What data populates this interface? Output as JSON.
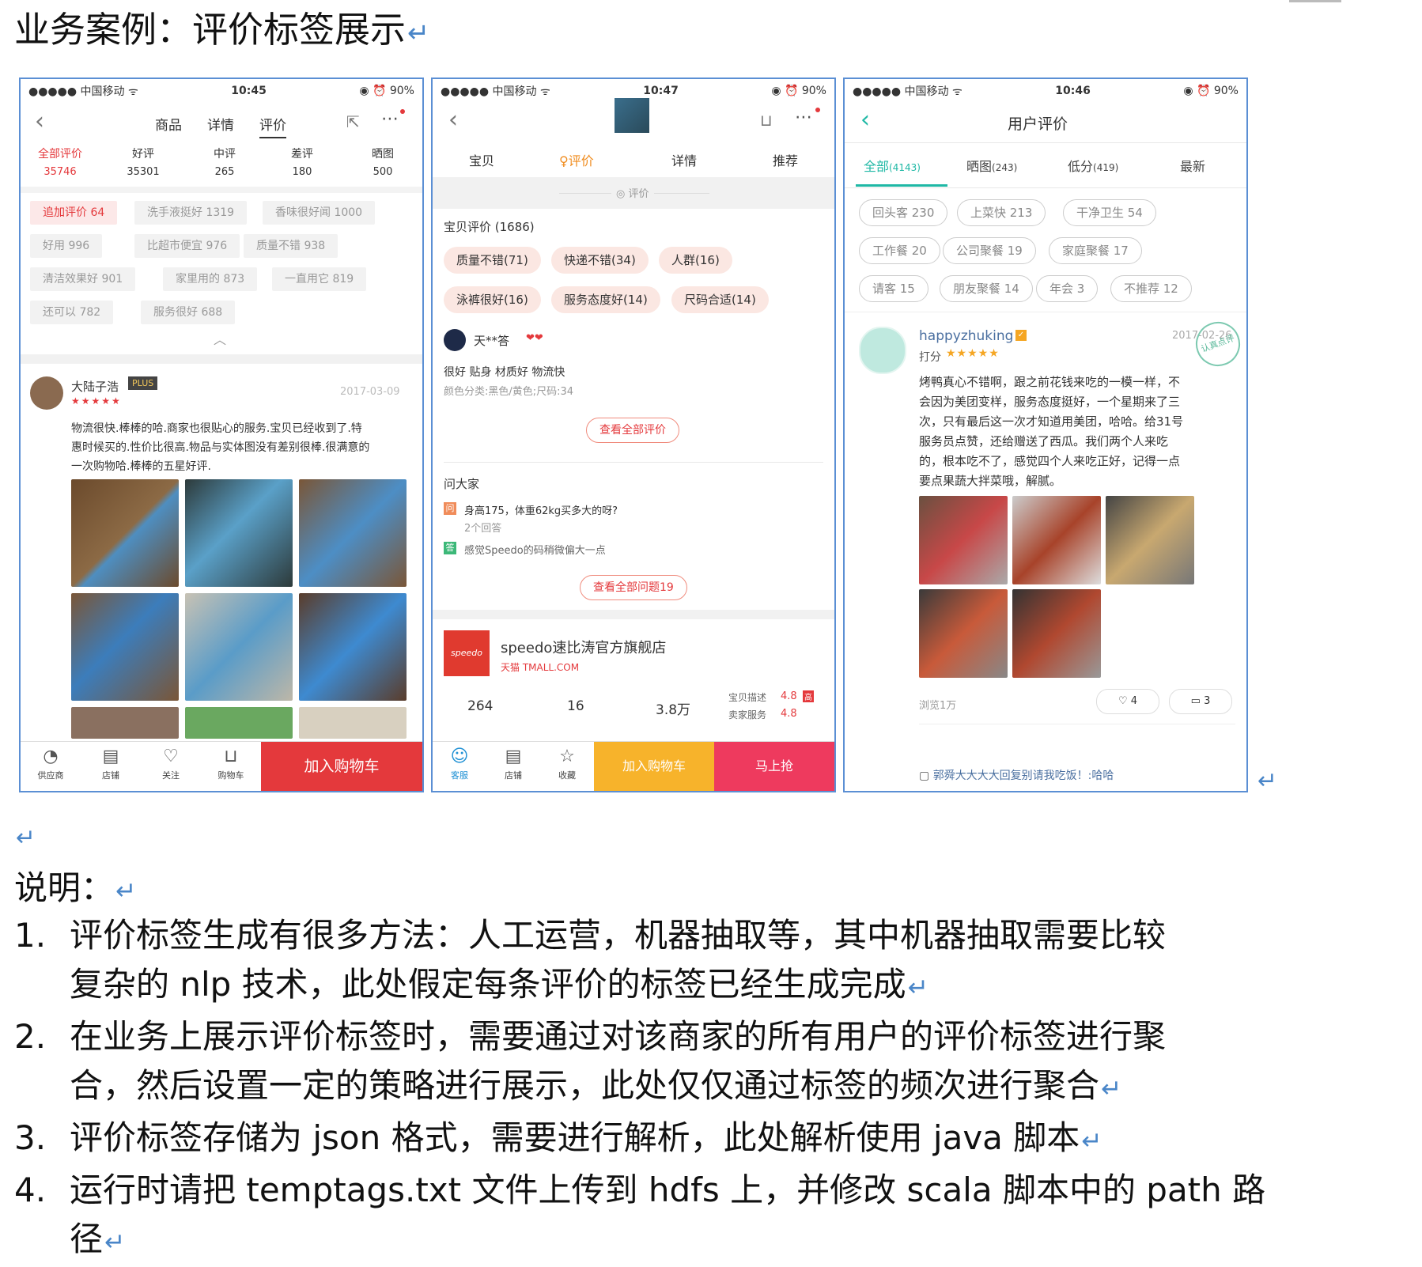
{
  "doc": {
    "title": "业务案例：评价标签展示",
    "explain_label": "说明：",
    "notes": [
      {
        "num": "1.",
        "line1": "评价标签生成有很多方法：人工运营，机器抽取等，其中机器抽取需要比较",
        "line2": "复杂的 nlp 技术，此处假定每条评价的标签已经生成完成"
      },
      {
        "num": "2.",
        "line1": "在业务上展示评价标签时，需要通过对该商家的所有用户的评价标签进行聚",
        "line2": "合，然后设置一定的策略进行展示，此处仅仅通过标签的频次进行聚合"
      },
      {
        "num": "3.",
        "line1": "评价标签存储为 json 格式，需要进行解析，此处解析使用 java 脚本"
      },
      {
        "num": "4.",
        "line1": "运行时请把 temptags.txt 文件上传到 hdfs 上，并修改 scala 脚本中的 path 路",
        "line2": "径"
      }
    ]
  },
  "phone1": {
    "carrier": "●●●●● 中国移动 ᯤ",
    "time": "10:45",
    "battery": "◉ ⏰ 90%",
    "nav": [
      "商品",
      "详情",
      "评价"
    ],
    "stats": [
      {
        "label": "全部评价",
        "count": "35746"
      },
      {
        "label": "好评",
        "count": "35301"
      },
      {
        "label": "中评",
        "count": "265"
      },
      {
        "label": "差评",
        "count": "180"
      },
      {
        "label": "晒图",
        "count": "500"
      }
    ],
    "chips": [
      "追加评价 64",
      "洗手液挺好 1319",
      "香味很好闻 1000",
      "好用 996",
      "比超市便宜 976",
      "质量不错 938",
      "清洁效果好 901",
      "家里用的 873",
      "一直用它 819",
      "还可以 782",
      "服务很好 688"
    ],
    "reviewer": "大陆子浩",
    "plus": "PLUS",
    "date": "2017-03-09",
    "stars": "★★★★★",
    "review": [
      "物流很快.棒棒的哈.商家也很贴心的服务.宝贝已经收到了.特",
      "惠时候买的.性价比很高.物品与实体图没有差别很棒.很满意的",
      "一次购物哈.棒棒的五星好评."
    ],
    "bottom": [
      "供应商",
      "店铺",
      "关注",
      "购物车"
    ],
    "cart": "加入购物车"
  },
  "phone2": {
    "carrier": "●●●●● 中国移动 ᯤ",
    "time": "10:47",
    "battery": "◉ ⏰ 90%",
    "tabs": [
      "宝贝",
      "评价",
      "详情",
      "推荐"
    ],
    "section_mini": "评价",
    "count_title": "宝贝评价 (1686)",
    "pills": [
      "质量不错(71)",
      "快递不错(34)",
      "人群(16)",
      "泳裤很好(16)",
      "服务态度好(14)",
      "尺码合适(14)"
    ],
    "user": "天**答",
    "user_badge": "❤❤",
    "review": "很好 贴身 材质好 物流快",
    "spec": "颜色分类:黑色/黄色;尺码:34",
    "see_all": "查看全部评价",
    "qa_title": "问大家",
    "q": "身高175，体重62kg买多大的呀?",
    "q_count": "2个回答",
    "a": "感觉Speedo的码稍微偏大一点",
    "see_q": "查看全部问题19",
    "shop_logo": "speedo",
    "shop": "speedo速比涛官方旗舰店",
    "tmall": "天猫 TMALL.COM",
    "shop_stats": [
      "264",
      "16",
      "3.8万"
    ],
    "score_label": "宝贝描述",
    "score": "4.8",
    "score2_label": "卖家服务",
    "score2": "4.8",
    "score_tag": "高",
    "bottom": [
      "客服",
      "店铺",
      "收藏"
    ],
    "cart": "加入购物车",
    "buy": "马上抢"
  },
  "phone3": {
    "carrier": "●●●●● 中国移动 ᯤ",
    "time": "10:46",
    "battery": "◉ ⏰ 90%",
    "title": "用户评价",
    "tabs": [
      {
        "label": "全部",
        "count": "(4143)"
      },
      {
        "label": "晒图",
        "count": "(243)"
      },
      {
        "label": "低分",
        "count": "(419)"
      },
      {
        "label": "最新",
        "count": ""
      }
    ],
    "chips": [
      "回头客 230",
      "上菜快 213",
      "干净卫生 54",
      "工作餐 20",
      "公司聚餐 19",
      "家庭聚餐 17",
      "请客 15",
      "朋友聚餐 14",
      "年会 3",
      "不推荐 12"
    ],
    "user": "happyzhuking",
    "date": "2017-02-26",
    "score_label": "打分",
    "stars": "★★★★★",
    "stamp": "认真点评",
    "review": [
      "烤鸭真心不错啊，跟之前花钱来吃的一模一样，不",
      "会因为美团变样，服务态度挺好，一个星期来了三",
      "次，只有最后这一次才知道用美团，哈哈。给31号",
      "服务员点赞，还给赠送了西瓜。我们两个人来吃",
      "的，根本吃不了，感觉四个人来吃正好，记得一点",
      "要点果蔬大拌菜哦，解腻。"
    ],
    "views": "浏览1万",
    "likes": "4",
    "comments": "3",
    "reply": "郭舜大大大大回复别请我吃饭！:哈哈"
  },
  "colors": {
    "accent_red": "#e4393c",
    "teal": "#1fb8a5",
    "frame_blue": "#5b8fd4"
  }
}
